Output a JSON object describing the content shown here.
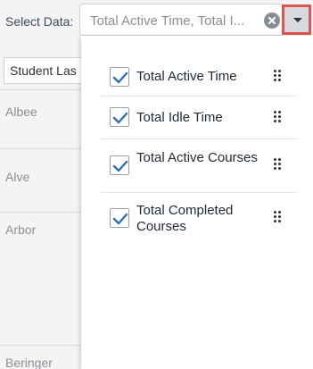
{
  "header": {
    "select_label": "Select Data:",
    "select_value": "Total Active Time, Total I..."
  },
  "table": {
    "column_header": "Student Las",
    "rows": [
      "Albee",
      "Alve",
      "Arbor",
      "Beringer"
    ]
  },
  "dropdown": {
    "items": [
      {
        "label": "Total Active Time",
        "checked": true
      },
      {
        "label": "Total Idle Time",
        "checked": true
      },
      {
        "label": "Total Active Courses",
        "checked": true
      },
      {
        "label": "Total Completed Courses",
        "checked": true
      }
    ]
  },
  "colors": {
    "highlight_border": "#e0564f",
    "check_color": "#2f6db5"
  },
  "icons": {
    "clear": "clear-icon",
    "dropdown": "chevron-down-icon",
    "checkbox": "checkmark-icon",
    "drag": "drag-handle-icon"
  }
}
